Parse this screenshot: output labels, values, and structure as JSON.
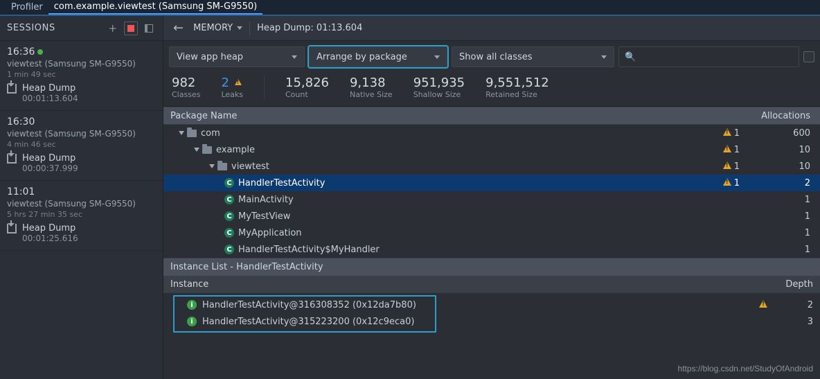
{
  "tabs": {
    "profiler": "Profiler",
    "target": "com.example.viewtest (Samsung SM-G9550)"
  },
  "sessions_label": "SESSIONS",
  "sessions": [
    {
      "time": "16:36",
      "active": true,
      "proc": "viewtest (Samsung SM-G9550)",
      "dur": "1 min 49 sec",
      "heap_label": "Heap Dump",
      "heap_ts": "00:01:13.604"
    },
    {
      "time": "16:30",
      "active": false,
      "proc": "viewtest (Samsung SM-G9550)",
      "dur": "4 min 46 sec",
      "heap_label": "Heap Dump",
      "heap_ts": "00:00:37.999"
    },
    {
      "time": "11:01",
      "active": false,
      "proc": "viewtest (Samsung SM-G9550)",
      "dur": "5 hrs 27 min 35 sec",
      "heap_label": "Heap Dump",
      "heap_ts": "00:01:25.616"
    }
  ],
  "toolbar": {
    "memory": "MEMORY",
    "heapdump": "Heap Dump: 01:13.604"
  },
  "filters": {
    "heap": "View app heap",
    "arrange": "Arrange by package",
    "classfilter": "Show all classes",
    "search_placeholder": ""
  },
  "stats": {
    "classes": {
      "num": "982",
      "lab": "Classes"
    },
    "leaks": {
      "num": "2",
      "lab": "Leaks"
    },
    "count": {
      "num": "15,826",
      "lab": "Count"
    },
    "native": {
      "num": "9,138",
      "lab": "Native Size"
    },
    "shallow": {
      "num": "951,935",
      "lab": "Shallow Size"
    },
    "retained": {
      "num": "9,551,512",
      "lab": "Retained Size"
    }
  },
  "table": {
    "hdr_name": "Package Name",
    "hdr_alloc": "Allocations",
    "rows": [
      {
        "depth": 1,
        "kind": "pkg",
        "expanded": true,
        "label": "com",
        "warn": "1",
        "alloc": "600"
      },
      {
        "depth": 2,
        "kind": "pkg",
        "expanded": true,
        "label": "example",
        "warn": "1",
        "alloc": "10"
      },
      {
        "depth": 3,
        "kind": "pkg",
        "expanded": true,
        "label": "viewtest",
        "warn": "1",
        "alloc": "10"
      },
      {
        "depth": 4,
        "kind": "cls",
        "selected": true,
        "label": "HandlerTestActivity",
        "warn": "1",
        "alloc": "2"
      },
      {
        "depth": 4,
        "kind": "cls",
        "label": "MainActivity",
        "warn": "",
        "alloc": "1"
      },
      {
        "depth": 4,
        "kind": "cls",
        "label": "MyTestView",
        "warn": "",
        "alloc": "1"
      },
      {
        "depth": 4,
        "kind": "cls",
        "label": "MyApplication",
        "warn": "",
        "alloc": "1"
      },
      {
        "depth": 4,
        "kind": "cls",
        "label": "HandlerTestActivity$MyHandler",
        "warn": "",
        "alloc": "1"
      }
    ]
  },
  "instances": {
    "title": "Instance List - HandlerTestActivity",
    "hdr_instance": "Instance",
    "hdr_depth": "Depth",
    "rows": [
      {
        "label": "HandlerTestActivity@316308352 (0x12da7b80)",
        "warn": true,
        "depth": "2"
      },
      {
        "label": "HandlerTestActivity@315223200 (0x12c9eca0)",
        "warn": false,
        "depth": "3"
      }
    ]
  },
  "watermark": "https://blog.csdn.net/StudyOfAndroid"
}
